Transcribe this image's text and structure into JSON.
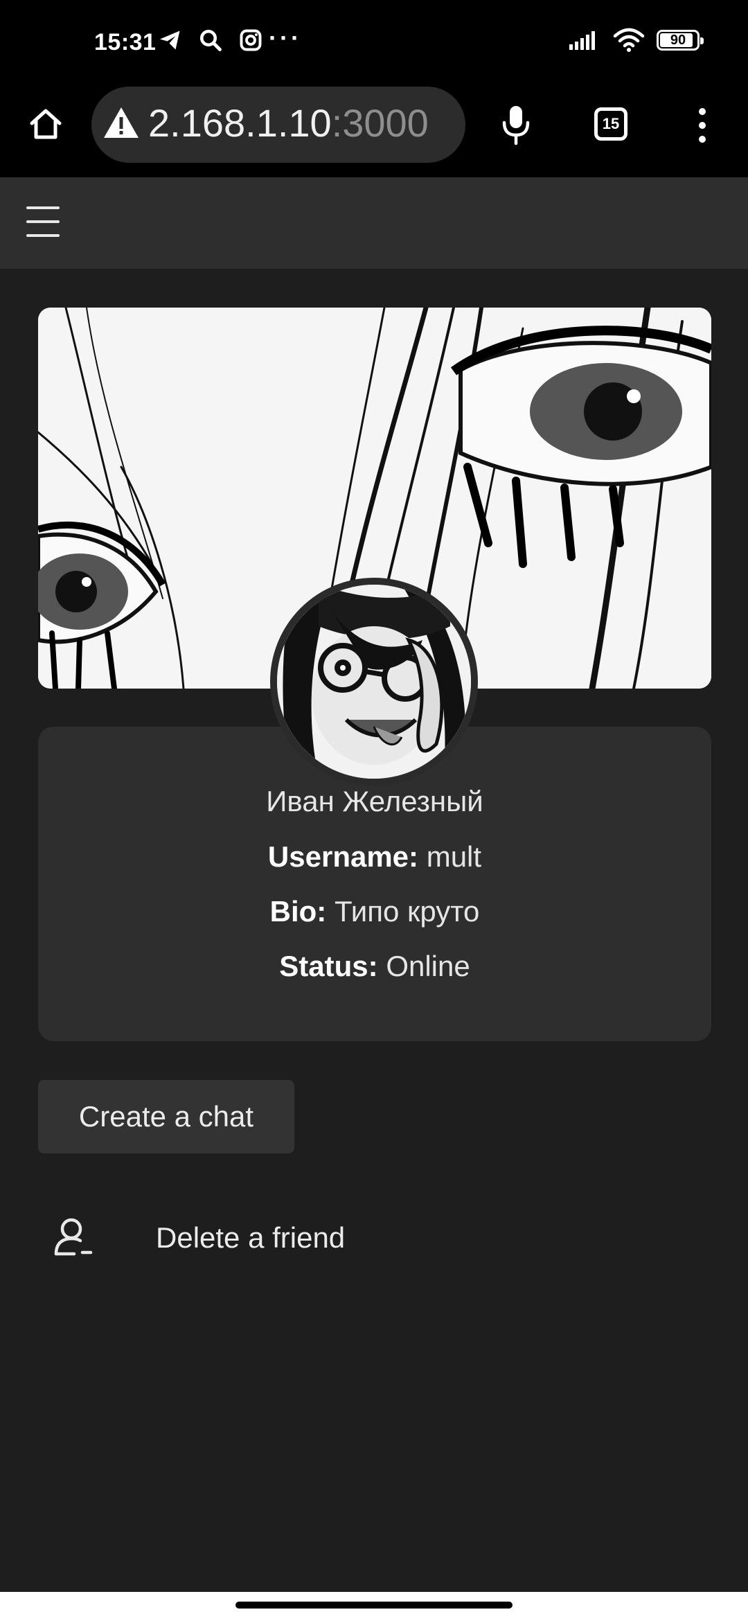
{
  "status_bar": {
    "time": "15:31",
    "left_icons": [
      "telegram-icon",
      "search-icon",
      "instagram-icon"
    ],
    "overflow": "···",
    "battery": "90",
    "battery_level": 0.9
  },
  "browser": {
    "url_host": "2.168.1.10",
    "url_port": ":3000",
    "tabs_count": "15"
  },
  "profile": {
    "name": "Иван Железный",
    "username_label": "Username:",
    "username": "mult",
    "bio_label": "Bio:",
    "bio": "Типо круто",
    "status_label": "Status:",
    "status": "Online"
  },
  "actions": {
    "create_chat": "Create a chat",
    "delete_friend": "Delete a friend"
  },
  "colors": {
    "background": "#1e1e1e",
    "card": "#2e2e2e",
    "header": "#2e2e2e",
    "button": "#333333"
  }
}
